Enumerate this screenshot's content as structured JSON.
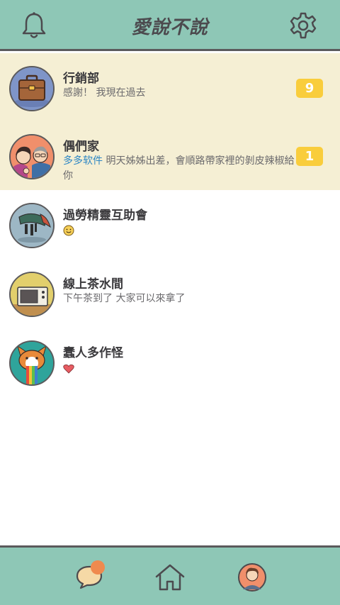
{
  "header": {
    "title": "愛說不說",
    "bell_icon": "bell-icon",
    "settings_icon": "gear-icon"
  },
  "chats": [
    {
      "name": "行銷部",
      "message": "感謝！ 我現在過去",
      "sender": "",
      "badge": "9",
      "unread": true,
      "avatar": "briefcase"
    },
    {
      "name": "偶們家",
      "sender": "多多软件",
      "message": "明天姊姊出差，會順路帶家裡的剝皮辣椒給你",
      "badge": "1",
      "unread": true,
      "avatar": "couple"
    },
    {
      "name": "過勞精靈互助會",
      "message": "",
      "sender": "",
      "badge": "",
      "unread": false,
      "avatar": "tired-elf",
      "emoji": "smiley"
    },
    {
      "name": "線上茶水間",
      "message": "下午茶到了 大家可以來拿了",
      "sender": "",
      "badge": "",
      "unread": false,
      "avatar": "microwave"
    },
    {
      "name": "蠢人多作怪",
      "message": "",
      "sender": "",
      "badge": "",
      "unread": false,
      "avatar": "corgi",
      "emoji": "heart"
    }
  ],
  "bottom_nav": {
    "chat_icon": "chat-bubble-icon",
    "home_icon": "home-icon",
    "profile_icon": "profile-avatar-icon"
  },
  "colors": {
    "accent": "#8ec7b6",
    "unread_bg": "#f5efd4",
    "badge": "#f9cd3c",
    "sender": "#2c86c4",
    "notification_dot": "#ef8a4e"
  }
}
